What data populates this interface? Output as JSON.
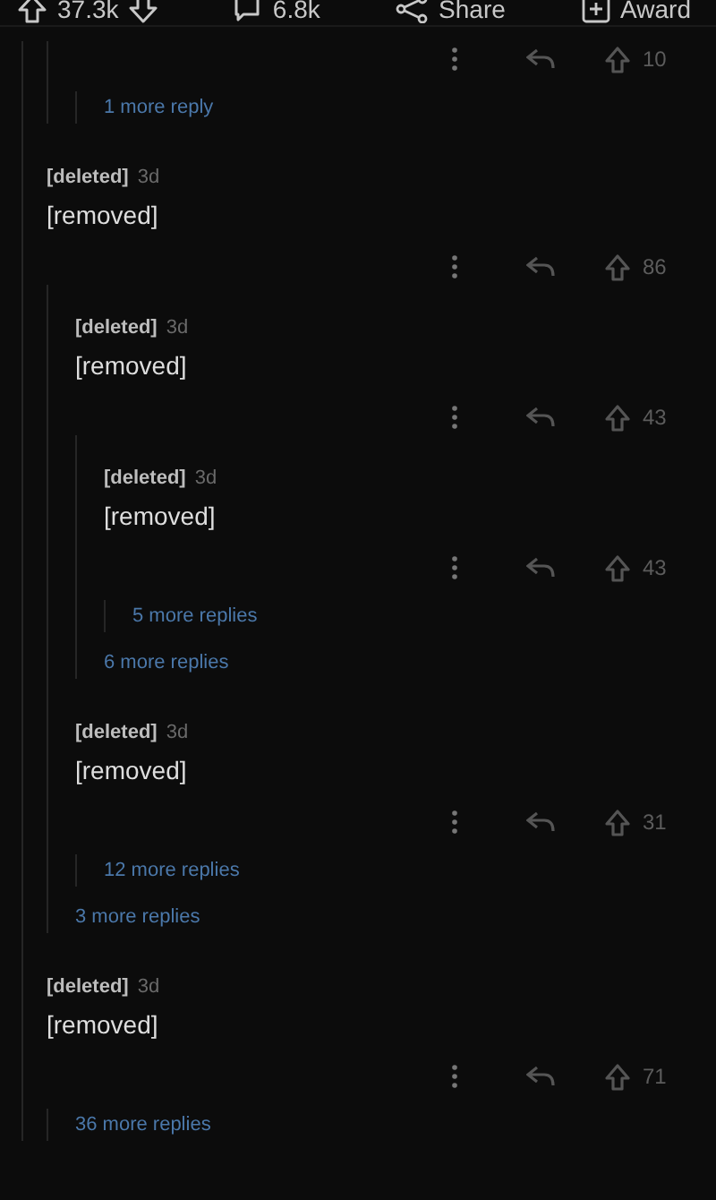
{
  "post_bar": {
    "upvotes": "37.3k",
    "comments": "6.8k",
    "share": "Share",
    "award": "Award"
  },
  "thread": [
    {
      "kind": "continued",
      "children": [
        {
          "kind": "actions",
          "score": "10",
          "children": [
            {
              "kind": "more",
              "label": "1 more reply"
            }
          ]
        }
      ]
    },
    {
      "kind": "comment",
      "author": "[deleted]",
      "age": "3d",
      "body": "[removed]",
      "score": "86",
      "children": [
        {
          "kind": "comment",
          "author": "[deleted]",
          "age": "3d",
          "body": "[removed]",
          "score": "43",
          "children": [
            {
              "kind": "comment",
              "author": "[deleted]",
              "age": "3d",
              "body": "[removed]",
              "score": "43",
              "children": [
                {
                  "kind": "more",
                  "label": "5 more replies"
                }
              ]
            },
            {
              "kind": "more",
              "label": "6 more replies"
            }
          ]
        },
        {
          "kind": "comment",
          "author": "[deleted]",
          "age": "3d",
          "body": "[removed]",
          "score": "31",
          "children": [
            {
              "kind": "more",
              "label": "12 more replies"
            }
          ]
        },
        {
          "kind": "more",
          "label": "3 more replies"
        }
      ]
    },
    {
      "kind": "comment",
      "author": "[deleted]",
      "age": "3d",
      "body": "[removed]",
      "score": "71",
      "children": [
        {
          "kind": "more",
          "label": "36 more replies"
        }
      ]
    }
  ]
}
